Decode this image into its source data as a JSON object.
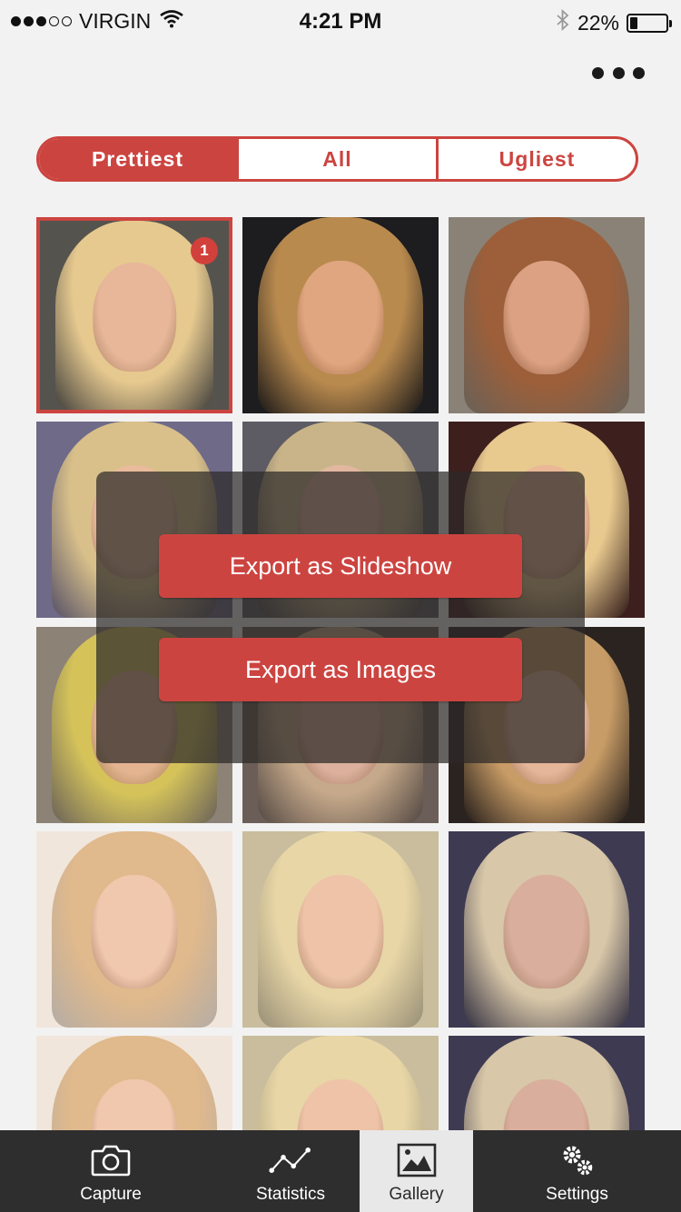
{
  "status_bar": {
    "carrier": "VIRGIN",
    "time": "4:21 PM",
    "battery": "22%",
    "battery_level": 0.22,
    "signal_bars_filled": 3,
    "signal_bars_total": 5
  },
  "segmented_control": {
    "segments": [
      "Prettiest",
      "All",
      "Ugliest"
    ],
    "selected": "Prettiest"
  },
  "gallery": {
    "selected_badge": "1",
    "photos": [
      {
        "hair": "#e6c98f",
        "skin": "#e8b79a",
        "bg": "#55534e"
      },
      {
        "hair": "#b98a4e",
        "skin": "#e0a67f",
        "bg": "#1d1c1e"
      },
      {
        "hair": "#9c5f3a",
        "skin": "#dba182",
        "bg": "#8a8277"
      },
      {
        "hair": "#d9c08a",
        "skin": "#e9bb9c",
        "bg": "#6f6a88"
      },
      {
        "hair": "#c9b489",
        "skin": "#e2b79f",
        "bg": "#5d5b63"
      },
      {
        "hair": "#e8c98e",
        "skin": "#eab797",
        "bg": "#3d1f1e"
      },
      {
        "hair": "#d5c35a",
        "skin": "#e4b491",
        "bg": "#8c8276"
      },
      {
        "hair": "#c6a98a",
        "skin": "#dcb09c",
        "bg": "#6b5e58"
      },
      {
        "hair": "#c89c66",
        "skin": "#e6b69a",
        "bg": "#2b2320"
      },
      {
        "hair": "#e0b98c",
        "skin": "#f0c8ae",
        "bg": "#f1e6dc"
      },
      {
        "hair": "#e8d6a6",
        "skin": "#eec3a8",
        "bg": "#c9bd9d"
      },
      {
        "hair": "#d8c7a8",
        "skin": "#d9ae9c",
        "bg": "#3e3a52"
      },
      {
        "hair": "#e0b98c",
        "skin": "#f0c8ae",
        "bg": "#f1e6dc"
      },
      {
        "hair": "#e8d6a6",
        "skin": "#eec3a8",
        "bg": "#c9bd9d"
      },
      {
        "hair": "#d8c7a8",
        "skin": "#d9ae9c",
        "bg": "#3e3a52"
      }
    ]
  },
  "export_menu": {
    "slideshow_label": "Export as Slideshow",
    "images_label": "Export as Images"
  },
  "tab_bar": {
    "tabs": [
      {
        "label": "Capture",
        "icon": "camera-icon"
      },
      {
        "label": "Statistics",
        "icon": "line-chart-icon"
      },
      {
        "label": "Gallery",
        "icon": "image-icon"
      },
      {
        "label": "Settings",
        "icon": "gears-icon"
      }
    ],
    "active": "Gallery"
  },
  "colors": {
    "accent": "#cc4440",
    "tab_bar": "#2e2e2e",
    "tab_active": "#e8e8e8",
    "background": "#f2f2f2"
  }
}
